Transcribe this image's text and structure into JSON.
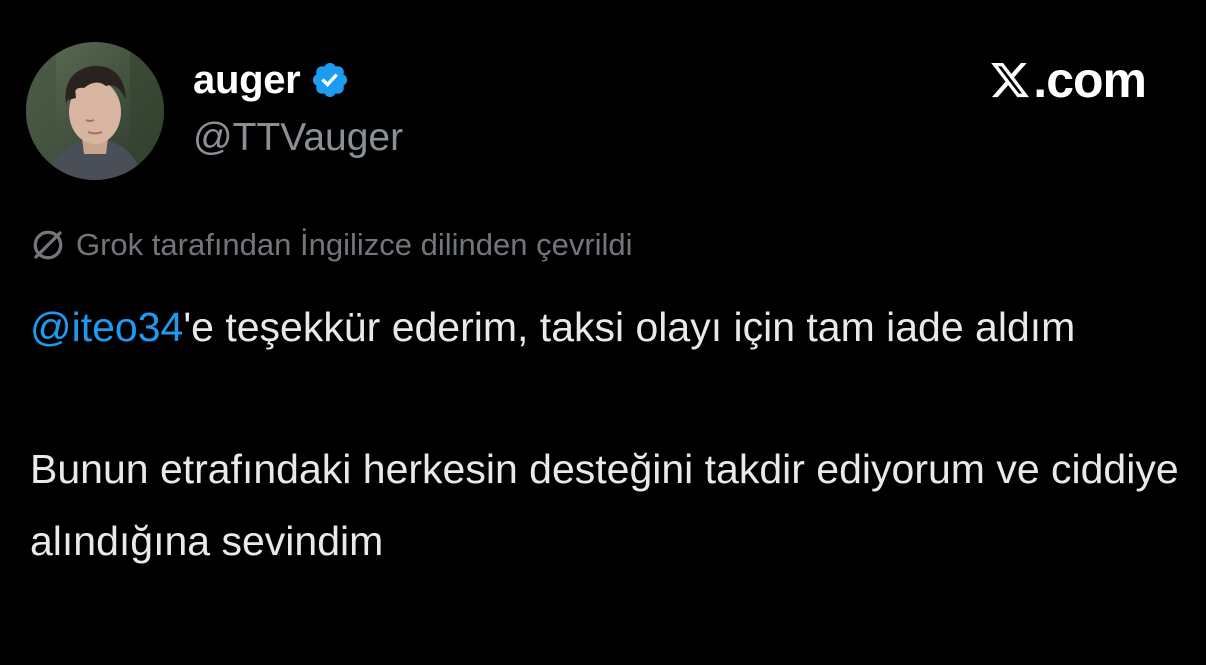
{
  "author": {
    "display_name": "auger",
    "handle": "@TTVauger",
    "verified": true,
    "avatar_icon": "profile-photo",
    "verified_icon": "verified-badge-icon"
  },
  "brand": {
    "icon": "x-logo-icon",
    "text": ".com"
  },
  "translation": {
    "icon": "grok-icon",
    "note": "Grok tarafından İngilizce dilinden çevrildi"
  },
  "tweet": {
    "mention": "@iteo34",
    "paragraph1_rest": "'e teşekkür ederim, taksi olayı için tam iade aldım",
    "paragraph2": "Bunun etrafındaki herkesin desteğini takdir ediyorum ve ciddiye alındığına sevindim"
  },
  "colors": {
    "background": "#000000",
    "text": "#e7e9ea",
    "secondary_text": "#8b9096",
    "muted_text": "#72767b",
    "mention": "#1d9bf0",
    "verified": "#1d9bf0"
  }
}
